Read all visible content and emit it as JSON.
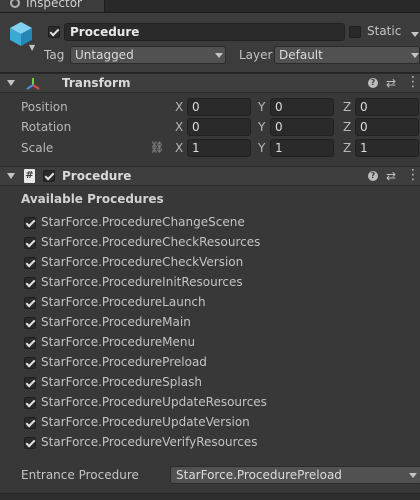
{
  "window": {
    "tab_title": "Inspector",
    "tab_icon": "info-icon"
  },
  "game_object": {
    "active": true,
    "name": "Procedure",
    "static_label": "Static",
    "static_checked": false,
    "tag_label": "Tag",
    "tag_value": "Untagged",
    "layer_label": "Layer",
    "layer_value": "Default"
  },
  "transform": {
    "title": "Transform",
    "rows": [
      {
        "label": "Position",
        "x": "0",
        "y": "0",
        "z": "0"
      },
      {
        "label": "Rotation",
        "x": "0",
        "y": "0",
        "z": "0"
      },
      {
        "label": "Scale",
        "x": "1",
        "y": "1",
        "z": "1"
      }
    ],
    "axis_labels": {
      "x": "X",
      "y": "Y",
      "z": "Z"
    }
  },
  "procedure_component": {
    "title": "Procedure",
    "enabled": true,
    "section_title": "Available Procedures",
    "procedures": [
      {
        "label": "StarForce.ProcedureChangeScene",
        "checked": true
      },
      {
        "label": "StarForce.ProcedureCheckResources",
        "checked": true
      },
      {
        "label": "StarForce.ProcedureCheckVersion",
        "checked": true
      },
      {
        "label": "StarForce.ProcedureInitResources",
        "checked": true
      },
      {
        "label": "StarForce.ProcedureLaunch",
        "checked": true
      },
      {
        "label": "StarForce.ProcedureMain",
        "checked": true
      },
      {
        "label": "StarForce.ProcedureMenu",
        "checked": true
      },
      {
        "label": "StarForce.ProcedurePreload",
        "checked": true
      },
      {
        "label": "StarForce.ProcedureSplash",
        "checked": true
      },
      {
        "label": "StarForce.ProcedureUpdateResources",
        "checked": true
      },
      {
        "label": "StarForce.ProcedureUpdateVersion",
        "checked": true
      },
      {
        "label": "StarForce.ProcedureVerifyResources",
        "checked": true
      }
    ],
    "entrance_label": "Entrance Procedure",
    "entrance_value": "StarForce.ProcedurePreload"
  },
  "icons": {
    "help": "?",
    "preset": "⇄",
    "menu": "⋮",
    "link": "⛓",
    "script": "#"
  }
}
